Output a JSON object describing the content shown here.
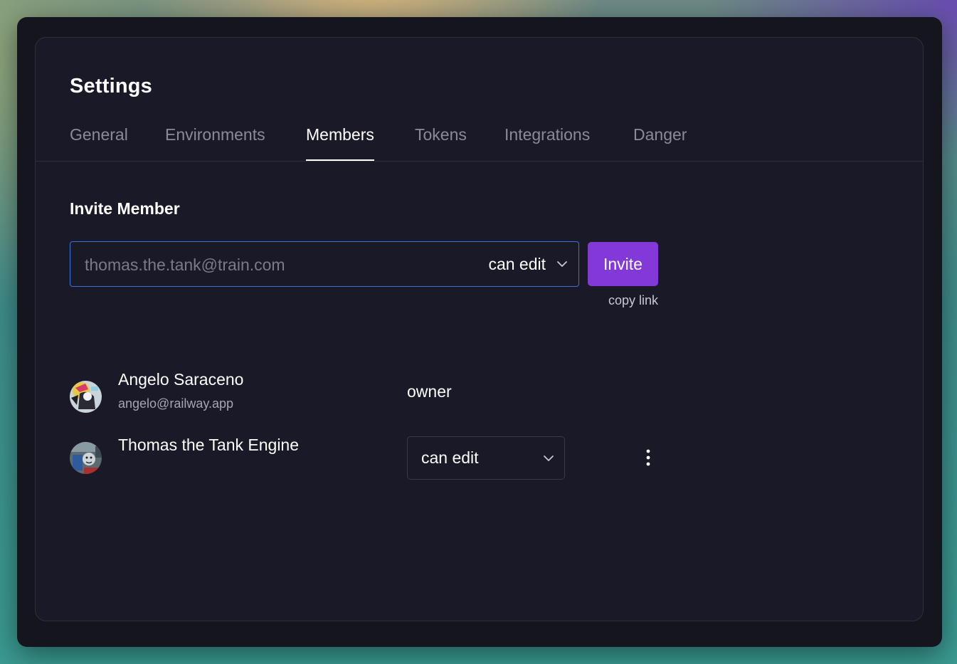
{
  "page": {
    "title": "Settings"
  },
  "tabs": [
    {
      "label": "General",
      "active": false
    },
    {
      "label": "Environments",
      "active": false
    },
    {
      "label": "Members",
      "active": true
    },
    {
      "label": "Tokens",
      "active": false
    },
    {
      "label": "Integrations",
      "active": false
    },
    {
      "label": "Danger",
      "active": false
    }
  ],
  "invite": {
    "section_title": "Invite Member",
    "email_placeholder": "thomas.the.tank@train.com",
    "email_value": "",
    "role_value": "can edit",
    "button_label": "Invite",
    "copy_link_label": "copy link"
  },
  "members": [
    {
      "name": "Angelo Saraceno",
      "email": "angelo@railway.app",
      "role": "owner",
      "avatar_icon": "user-avatar-icon"
    },
    {
      "name": "Thomas the Tank Engine",
      "role": "can edit",
      "avatar_icon": "train-avatar-icon"
    }
  ],
  "colors": {
    "window_bg": "#15151d",
    "card_bg": "#191927",
    "accent_purple": "#8239d8",
    "focus_blue": "#3b6fd9",
    "muted_text": "#8b8b98"
  }
}
